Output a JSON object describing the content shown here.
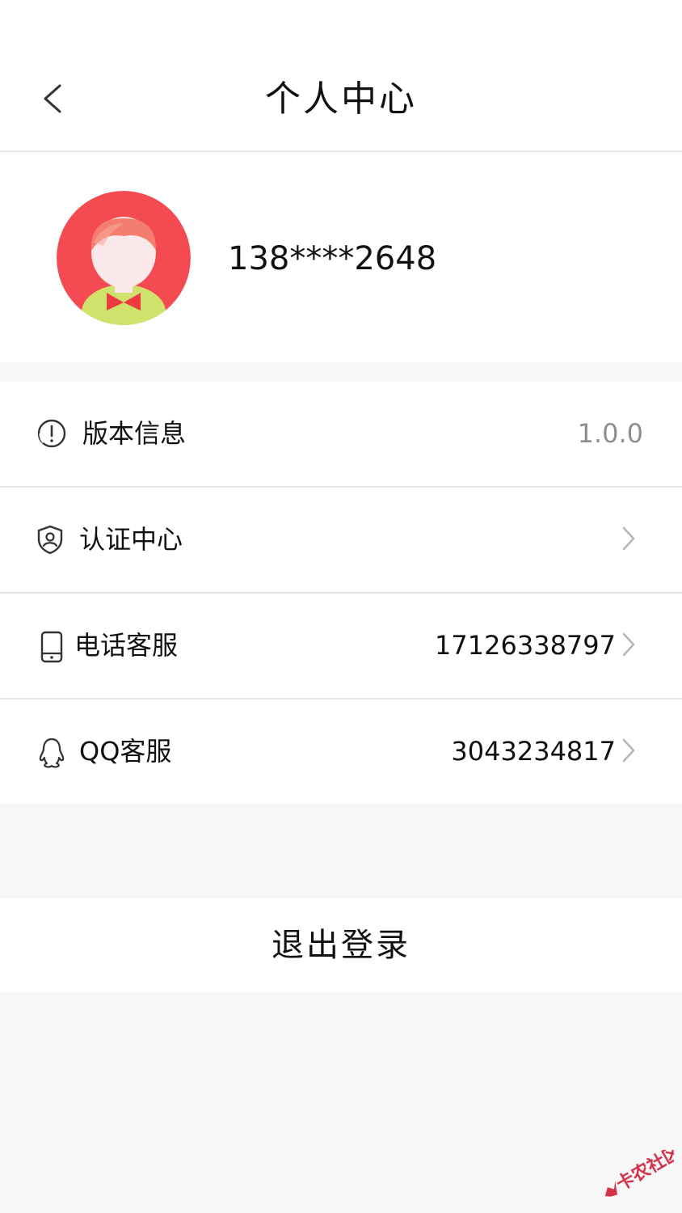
{
  "header": {
    "title": "个人中心",
    "back_icon": "chevron-left-icon"
  },
  "profile": {
    "avatar_icon": "default-avatar-girl",
    "phone": "138****2648",
    "avatar_bg": "#f44b52"
  },
  "menu": {
    "items": [
      {
        "icon": "info-circle-icon",
        "label": "版本信息",
        "value": "1.0.0",
        "has_chevron": false
      },
      {
        "icon": "shield-user-icon",
        "label": "认证中心",
        "value": "",
        "has_chevron": true
      },
      {
        "icon": "mobile-phone-icon",
        "label": "电话客服",
        "value": "17126338797",
        "has_chevron": true
      },
      {
        "icon": "qq-penguin-icon",
        "label": "QQ客服",
        "value": "3043234817",
        "has_chevron": true
      }
    ]
  },
  "logout": {
    "label": "退出登录"
  },
  "watermark": {
    "text": "卡农社区"
  }
}
